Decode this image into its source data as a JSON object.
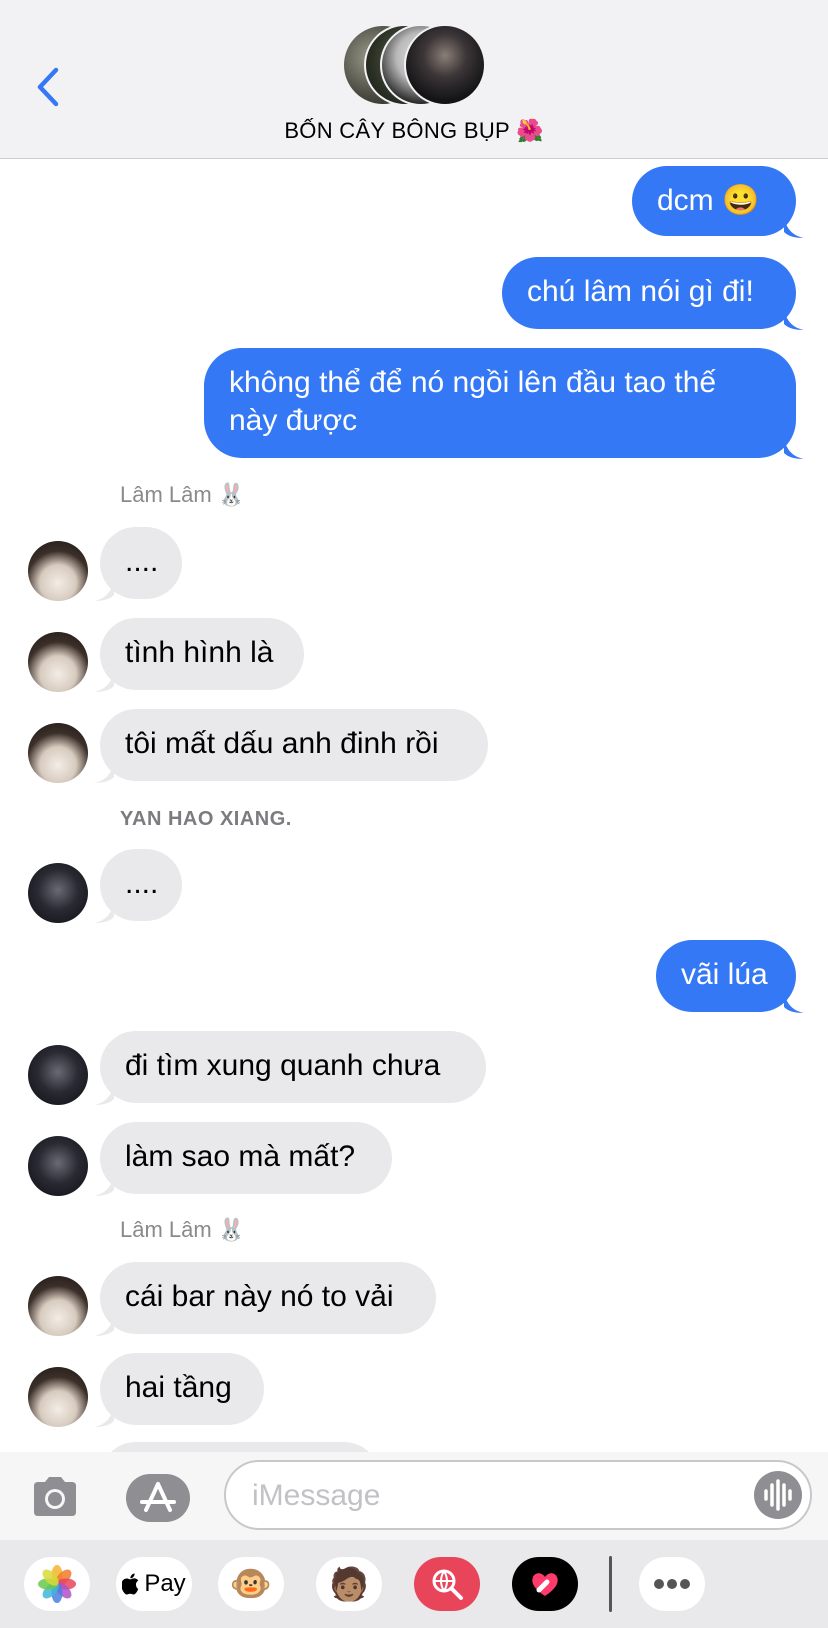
{
  "header": {
    "title": "BỐN CÂY BÔNG BỤP",
    "title_emoji": "🌺"
  },
  "messages": [
    {
      "id": "m1",
      "side": "out",
      "text": "dcm 😀"
    },
    {
      "id": "m2",
      "side": "out",
      "text": "chú lâm nói gì đi!"
    },
    {
      "id": "m3",
      "side": "out",
      "lines": [
        "không thể để nó ngồi lên đầu tao thế",
        "này được"
      ]
    },
    {
      "id": "s1",
      "type": "sender",
      "text": "Lâm Lâm 🐰"
    },
    {
      "id": "m4",
      "side": "in",
      "sender": "Lâm Lâm",
      "text": "...."
    },
    {
      "id": "m5",
      "side": "in",
      "sender": "Lâm Lâm",
      "text": "tình hình là"
    },
    {
      "id": "m6",
      "side": "in",
      "sender": "Lâm Lâm",
      "text": "tôi mất dấu anh đinh rồi"
    },
    {
      "id": "s2",
      "type": "sender",
      "text": "YAN HAO XIANG."
    },
    {
      "id": "m7",
      "side": "in",
      "sender": "YAN HAO XIANG.",
      "text": "...."
    },
    {
      "id": "m8",
      "side": "out",
      "text": "vãi lúa"
    },
    {
      "id": "m9",
      "side": "in",
      "sender": "YAN HAO XIANG.",
      "text": "đi tìm xung quanh chưa"
    },
    {
      "id": "m10",
      "side": "in",
      "sender": "YAN HAO XIANG.",
      "text": "làm sao mà mất?"
    },
    {
      "id": "s3",
      "type": "sender",
      "text": "Lâm Lâm 🐰"
    },
    {
      "id": "m11",
      "side": "in",
      "sender": "Lâm Lâm",
      "text": "cái bar này nó to vải"
    },
    {
      "id": "m12",
      "side": "in",
      "sender": "Lâm Lâm",
      "text": "hai tầng"
    }
  ],
  "input": {
    "placeholder": "iMessage"
  },
  "app_drawer": {
    "items": [
      {
        "name": "photos",
        "icon": "photos-icon"
      },
      {
        "name": "apple-pay",
        "label": "Pay",
        "icon": "apple-icon"
      },
      {
        "name": "animoji",
        "icon": "monkey-icon",
        "emoji": "🐵"
      },
      {
        "name": "memoji",
        "icon": "memoji-icon",
        "emoji": "🧑🏽"
      },
      {
        "name": "images-search",
        "icon": "globe-search-icon"
      },
      {
        "name": "digital-touch",
        "icon": "heart-touch-icon"
      },
      {
        "name": "more",
        "icon": "more-icon"
      }
    ]
  },
  "colors": {
    "outgoing": "#3478f6",
    "incoming": "#e9e9eb",
    "accent": "#3478f6"
  }
}
